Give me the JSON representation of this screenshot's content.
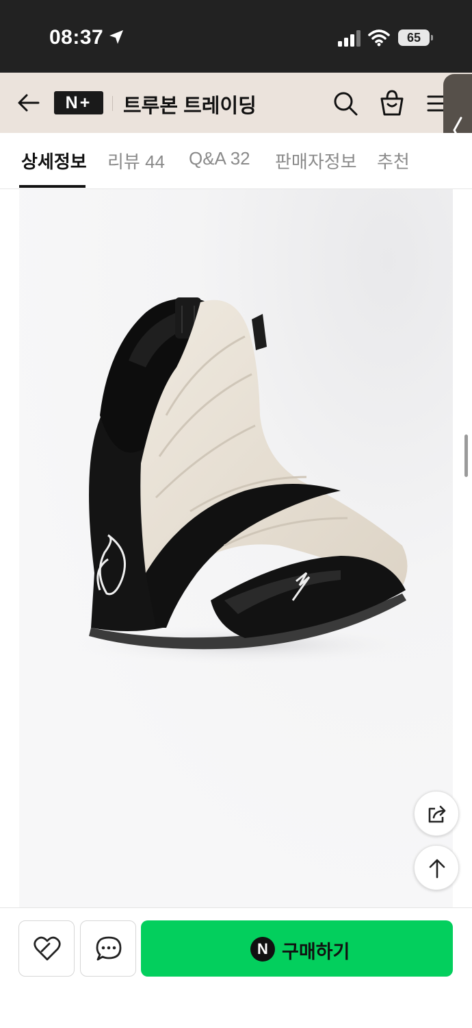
{
  "status_bar": {
    "time": "08:37",
    "battery": "65"
  },
  "header": {
    "logo": "N+",
    "store_name": "트루본 트레이딩"
  },
  "tabs": [
    {
      "label": "상세정보",
      "active": true
    },
    {
      "label": "리뷰 44",
      "active": false
    },
    {
      "label": "Q&A 32",
      "active": false
    },
    {
      "label": "판매자정보",
      "active": false
    },
    {
      "label": "추천",
      "active": false
    }
  ],
  "product_image": {
    "subject": "high-top wrestling shoe, cream and black suede"
  },
  "bottom_bar": {
    "buy_badge": "N",
    "buy_label": "구매하기"
  },
  "colors": {
    "accent": "#03cf5d",
    "header_bg": "#ebe3dc",
    "status_bg": "#222222"
  }
}
